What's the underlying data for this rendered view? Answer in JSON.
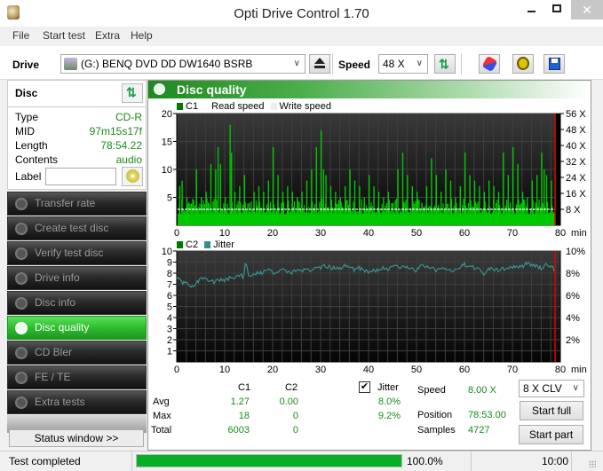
{
  "window": {
    "title": "Opti Drive Control 1.70",
    "close_glyph": "✕"
  },
  "menu": [
    "File",
    "Start test",
    "Extra",
    "Help"
  ],
  "toolbar": {
    "drive_label": "Drive",
    "drive_value": "(G:)  BENQ DVD DD DW1640 BSRB",
    "speed_label": "Speed",
    "speed_value": "48 X"
  },
  "disc": {
    "title": "Disc",
    "rows": [
      {
        "key": "Type",
        "value": "CD-R"
      },
      {
        "key": "MID",
        "value": "97m15s17f"
      },
      {
        "key": "Length",
        "value": "78:54.22"
      },
      {
        "key": "Contents",
        "value": "audio"
      }
    ],
    "label_key": "Label",
    "label_value": ""
  },
  "nav": [
    {
      "label": "Transfer rate",
      "active": false
    },
    {
      "label": "Create test disc",
      "active": false
    },
    {
      "label": "Verify test disc",
      "active": false
    },
    {
      "label": "Drive info",
      "active": false
    },
    {
      "label": "Disc info",
      "active": false
    },
    {
      "label": "Disc quality",
      "active": true
    },
    {
      "label": "CD Bler",
      "active": false
    },
    {
      "label": "FE / TE",
      "active": false
    },
    {
      "label": "Extra tests",
      "active": false
    }
  ],
  "status_window_label": "Status window >>",
  "panel_title": "Disc quality",
  "colors": {
    "c1": "#00c800",
    "jitter": "#3a8a8a",
    "legend_c1": "#007a00",
    "accent_green": "#1e8a1e",
    "read_speed": "#ffffff",
    "end_marker": "#e00000"
  },
  "chart_data": [
    {
      "type": "bar",
      "title": "C1 / Read speed",
      "legend": [
        "C1",
        "Read speed",
        "Write speed"
      ],
      "xlabel": "min",
      "x_ticks": [
        0,
        10,
        20,
        30,
        40,
        50,
        60,
        70,
        80
      ],
      "xlim": [
        0,
        80
      ],
      "y_left_ticks": [
        5,
        10,
        15,
        20
      ],
      "ylim": [
        0,
        20
      ],
      "y_right_ticks": [
        "8 X",
        "16 X",
        "24 X",
        "32 X",
        "40 X",
        "48 X",
        "56 X"
      ],
      "y_right_lim": [
        0,
        56
      ],
      "read_speed_x": 8,
      "disc_end_min": 78.9,
      "c1_peaks": [
        [
          0.5,
          7
        ],
        [
          1,
          8
        ],
        [
          2,
          5
        ],
        [
          3,
          3
        ],
        [
          4,
          10
        ],
        [
          5,
          5
        ],
        [
          6,
          6
        ],
        [
          7,
          11
        ],
        [
          8,
          10
        ],
        [
          8.5,
          14
        ],
        [
          9,
          11
        ],
        [
          10,
          5
        ],
        [
          11,
          18
        ],
        [
          11.3,
          13
        ],
        [
          12,
          6
        ],
        [
          13,
          7
        ],
        [
          14,
          9
        ],
        [
          15,
          4
        ],
        [
          16,
          6
        ],
        [
          17,
          7
        ],
        [
          18,
          6
        ],
        [
          19,
          8
        ],
        [
          20,
          14
        ],
        [
          21,
          9
        ],
        [
          22,
          6
        ],
        [
          23,
          7
        ],
        [
          24,
          6
        ],
        [
          25,
          5
        ],
        [
          26,
          6
        ],
        [
          27,
          8
        ],
        [
          28,
          10
        ],
        [
          29,
          14
        ],
        [
          30,
          17
        ],
        [
          30.5,
          10
        ],
        [
          31,
          9
        ],
        [
          32,
          7
        ],
        [
          33,
          6
        ],
        [
          34,
          5
        ],
        [
          35,
          7
        ],
        [
          36,
          10
        ],
        [
          37,
          8
        ],
        [
          38,
          7
        ],
        [
          39,
          5
        ],
        [
          40,
          9
        ],
        [
          41,
          7
        ],
        [
          42,
          6
        ],
        [
          43,
          5
        ],
        [
          44,
          6
        ],
        [
          45,
          4
        ],
        [
          46,
          10
        ],
        [
          47,
          13
        ],
        [
          48,
          9
        ],
        [
          49,
          7
        ],
        [
          50,
          6
        ],
        [
          51,
          4
        ],
        [
          52,
          7
        ],
        [
          53,
          12
        ],
        [
          54,
          9
        ],
        [
          55,
          6
        ],
        [
          56,
          10
        ],
        [
          57,
          8
        ],
        [
          58,
          5
        ],
        [
          59,
          7
        ],
        [
          60,
          13
        ],
        [
          61,
          9
        ],
        [
          62,
          8
        ],
        [
          63,
          7
        ],
        [
          64,
          6
        ],
        [
          65,
          8
        ],
        [
          66,
          7
        ],
        [
          67,
          6
        ],
        [
          68,
          13
        ],
        [
          69,
          9
        ],
        [
          70,
          14
        ],
        [
          71,
          11
        ],
        [
          72,
          6
        ],
        [
          73,
          5
        ],
        [
          74,
          8
        ],
        [
          75,
          9
        ],
        [
          76,
          13
        ],
        [
          76.5,
          10
        ],
        [
          77,
          9
        ],
        [
          78,
          8
        ]
      ],
      "c1_baseline": 2,
      "c1_avg": 1.27,
      "c1_max": 18,
      "c1_total": 6003
    },
    {
      "type": "line",
      "title": "C2 / Jitter",
      "legend": [
        "C2",
        "Jitter"
      ],
      "xlabel": "min",
      "x_ticks": [
        0,
        10,
        20,
        30,
        40,
        50,
        60,
        70,
        80
      ],
      "xlim": [
        0,
        80
      ],
      "y_left_ticks": [
        1,
        2,
        3,
        4,
        5,
        6,
        7,
        8,
        9,
        10
      ],
      "ylim": [
        0,
        10
      ],
      "y_right_ticks": [
        "2%",
        "4%",
        "6%",
        "8%",
        "10%"
      ],
      "y_right_lim": [
        0,
        10
      ],
      "jitter_series": [
        [
          0,
          7.8
        ],
        [
          1,
          7.2
        ],
        [
          2,
          7.1
        ],
        [
          3,
          6.7
        ],
        [
          4,
          7.0
        ],
        [
          5,
          7.6
        ],
        [
          6,
          7.4
        ],
        [
          7,
          7.3
        ],
        [
          8,
          7.2
        ],
        [
          9,
          7.4
        ],
        [
          10,
          7.3
        ],
        [
          11,
          7.6
        ],
        [
          12,
          7.5
        ],
        [
          13,
          7.8
        ],
        [
          14,
          7.7
        ],
        [
          14.3,
          9.0
        ],
        [
          15,
          7.9
        ],
        [
          16,
          7.9
        ],
        [
          17,
          8.0
        ],
        [
          18,
          8.0
        ],
        [
          19,
          8.4
        ],
        [
          20,
          8.0
        ],
        [
          21,
          8.1
        ],
        [
          22,
          8.4
        ],
        [
          23,
          8.2
        ],
        [
          24,
          8.0
        ],
        [
          25,
          8.3
        ],
        [
          26,
          8.1
        ],
        [
          27,
          8.4
        ],
        [
          28,
          8.3
        ],
        [
          29,
          8.6
        ],
        [
          30,
          8.4
        ],
        [
          31,
          8.7
        ],
        [
          32,
          8.5
        ],
        [
          33,
          8.5
        ],
        [
          34,
          8.4
        ],
        [
          35,
          8.7
        ],
        [
          36,
          8.6
        ],
        [
          37,
          8.3
        ],
        [
          38,
          8.5
        ],
        [
          39,
          8.2
        ],
        [
          40,
          8.1
        ],
        [
          41,
          8.3
        ],
        [
          42,
          8.2
        ],
        [
          43,
          8.5
        ],
        [
          44,
          8.3
        ],
        [
          45,
          8.5
        ],
        [
          46,
          8.6
        ],
        [
          47,
          8.5
        ],
        [
          48,
          8.6
        ],
        [
          49,
          8.4
        ],
        [
          50,
          8.2
        ],
        [
          51,
          8.8
        ],
        [
          52,
          8.6
        ],
        [
          53,
          8.5
        ],
        [
          54,
          8.3
        ],
        [
          55,
          8.4
        ],
        [
          56,
          8.4
        ],
        [
          57,
          8.2
        ],
        [
          58,
          8.3
        ],
        [
          59,
          8.5
        ],
        [
          60,
          8.8
        ],
        [
          61,
          8.6
        ],
        [
          62,
          8.5
        ],
        [
          63,
          8.4
        ],
        [
          64,
          8.0
        ],
        [
          65,
          8.3
        ],
        [
          66,
          8.4
        ],
        [
          67,
          8.3
        ],
        [
          68,
          8.4
        ],
        [
          69,
          8.5
        ],
        [
          70,
          8.6
        ],
        [
          71,
          8.5
        ],
        [
          72,
          8.6
        ],
        [
          73,
          8.9
        ],
        [
          74,
          8.7
        ],
        [
          75,
          8.7
        ],
        [
          76,
          8.4
        ],
        [
          77,
          8.8
        ],
        [
          78,
          8.7
        ],
        [
          78.9,
          8.2
        ]
      ],
      "c2_total": 0,
      "jitter_avg": "8.0%",
      "jitter_max": "9.2%"
    }
  ],
  "stats": {
    "col_c1": "C1",
    "col_c2": "C2",
    "jitter_label": "Jitter",
    "jitter_checked": true,
    "check_glyph": "✔",
    "rows": [
      {
        "label": "Avg",
        "c1": "1.27",
        "c2": "0.00",
        "jitter": "8.0%"
      },
      {
        "label": "Max",
        "c1": "18",
        "c2": "0",
        "jitter": "9.2%"
      },
      {
        "label": "Total",
        "c1": "6003",
        "c2": "0",
        "jitter": ""
      }
    ],
    "speed_label": "Speed",
    "speed_value": "8.00 X",
    "position_label": "Position",
    "position_value": "78:53.00",
    "samples_label": "Samples",
    "samples_value": "4727",
    "mode_select": "8 X CLV",
    "start_full": "Start full",
    "start_part": "Start part"
  },
  "statusbar": {
    "text": "Test completed",
    "progress": 1.0,
    "progress_text": "100.0%",
    "time": "10:00"
  }
}
